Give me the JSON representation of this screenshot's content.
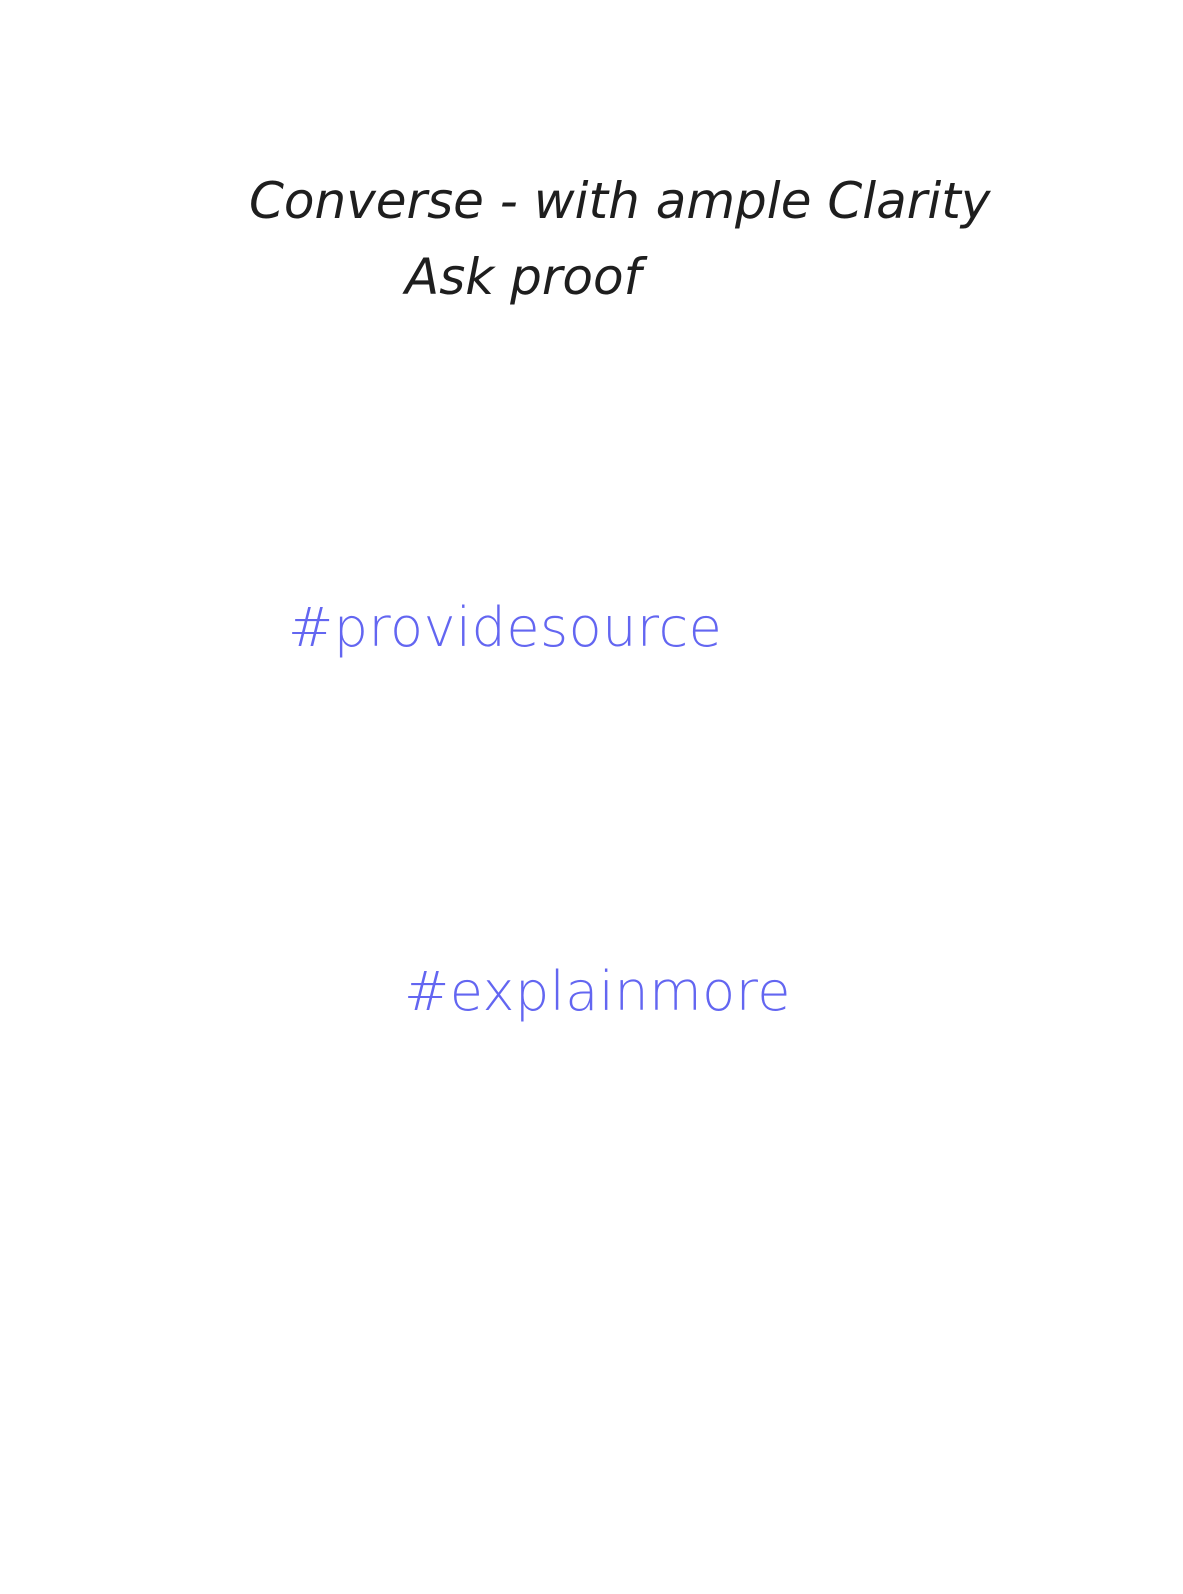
{
  "heading": {
    "line1": "Converse - with ample Clarity",
    "line2": "Ask proof"
  },
  "hashtags": [
    {
      "text": "#providesource"
    },
    {
      "text": "#explainmore"
    }
  ],
  "colors": {
    "heading_text": "#1e1e1e",
    "hashtag_text": "#6366f1",
    "background": "#ffffff"
  }
}
